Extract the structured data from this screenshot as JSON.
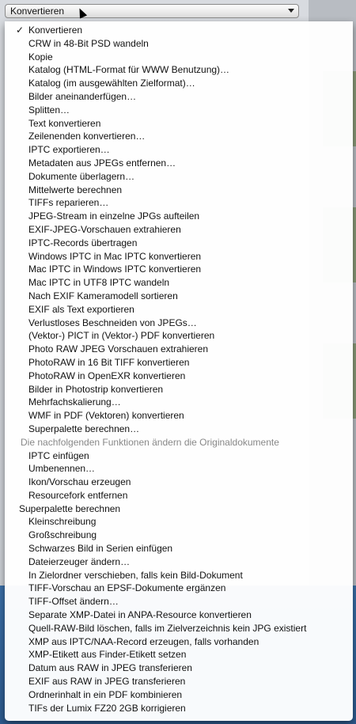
{
  "popup": {
    "selected": "Konvertieren"
  },
  "menu": {
    "checked_index": 0,
    "items": [
      {
        "label": "Konvertieren",
        "checked": true
      },
      {
        "label": "CRW in 48-Bit PSD wandeln"
      },
      {
        "label": "Kopie"
      },
      {
        "label": "Katalog (HTML-Format für WWW Benutzung)…"
      },
      {
        "label": "Katalog (im ausgewählten Zielformat)…"
      },
      {
        "label": "Bilder aneinanderfügen…"
      },
      {
        "label": "Splitten…"
      },
      {
        "label": "Text konvertieren"
      },
      {
        "label": "Zeilenenden konvertieren…"
      },
      {
        "label": "IPTC exportieren…"
      },
      {
        "label": "Metadaten aus JPEGs entfernen…"
      },
      {
        "label": "Dokumente überlagern…"
      },
      {
        "label": "Mittelwerte berechnen"
      },
      {
        "label": "TIFFs reparieren…"
      },
      {
        "label": "JPEG-Stream in einzelne JPGs aufteilen"
      },
      {
        "label": "EXIF-JPEG-Vorschauen extrahieren"
      },
      {
        "label": "IPTC-Records übertragen"
      },
      {
        "label": "Windows IPTC in Mac IPTC konvertieren"
      },
      {
        "label": "Mac IPTC in Windows IPTC konvertieren"
      },
      {
        "label": "Mac IPTC in UTF8 IPTC wandeln"
      },
      {
        "label": "Nach EXIF Kameramodell sortieren"
      },
      {
        "label": "EXIF als Text exportieren"
      },
      {
        "label": "Verlustloses Beschneiden von JPEGs…"
      },
      {
        "label": "(Vektor-) PICT in (Vektor-) PDF konvertieren"
      },
      {
        "label": "Photo RAW JPEG Vorschauen extrahieren"
      },
      {
        "label": "PhotoRAW in 16 Bit TIFF konvertieren"
      },
      {
        "label": "PhotoRAW in OpenEXR konvertieren"
      },
      {
        "label": "Bilder in Photostrip konvertieren"
      },
      {
        "label": "Mehrfachskalierung…"
      },
      {
        "label": "WMF in PDF (Vektoren) konvertieren"
      },
      {
        "label": "Superpalette berechnen…"
      }
    ],
    "section_header": "Die nachfolgenden Funktionen ändern die Originaldokumente",
    "items2": [
      {
        "label": "IPTC einfügen"
      },
      {
        "label": "Umbenennen…"
      },
      {
        "label": "Ikon/Vorschau erzeugen"
      },
      {
        "label": "Resourcefork entfernen"
      }
    ],
    "group_title": "Superpalette berechnen",
    "items3": [
      {
        "label": "Kleinschreibung"
      },
      {
        "label": "Großschreibung"
      },
      {
        "label": "Schwarzes Bild in Serien einfügen"
      },
      {
        "label": "Dateierzeuger ändern…"
      },
      {
        "label": "In Zielordner verschieben, falls kein Bild-Dokument"
      },
      {
        "label": "TIFF-Vorschau an EPSF-Dokumente ergänzen"
      },
      {
        "label": "TIFF-Offset ändern…"
      },
      {
        "label": "Separate XMP-Datei in ANPA-Resource konvertieren"
      },
      {
        "label": "Quell-RAW-Bild löschen, falls im Zielverzeichnis kein JPG existiert"
      },
      {
        "label": "XMP aus IPTC/NAA-Record erzeugen, falls vorhanden"
      },
      {
        "label": "XMP-Etikett aus Finder-Etikett setzen"
      },
      {
        "label": "Datum aus RAW in JPEG transferieren"
      },
      {
        "label": "EXIF aus RAW in JPEG transferieren"
      },
      {
        "label": "Ordnerinhalt in ein PDF kombinieren"
      },
      {
        "label": "TIFs der Lumix FZ20 2GB korrigieren"
      }
    ]
  }
}
